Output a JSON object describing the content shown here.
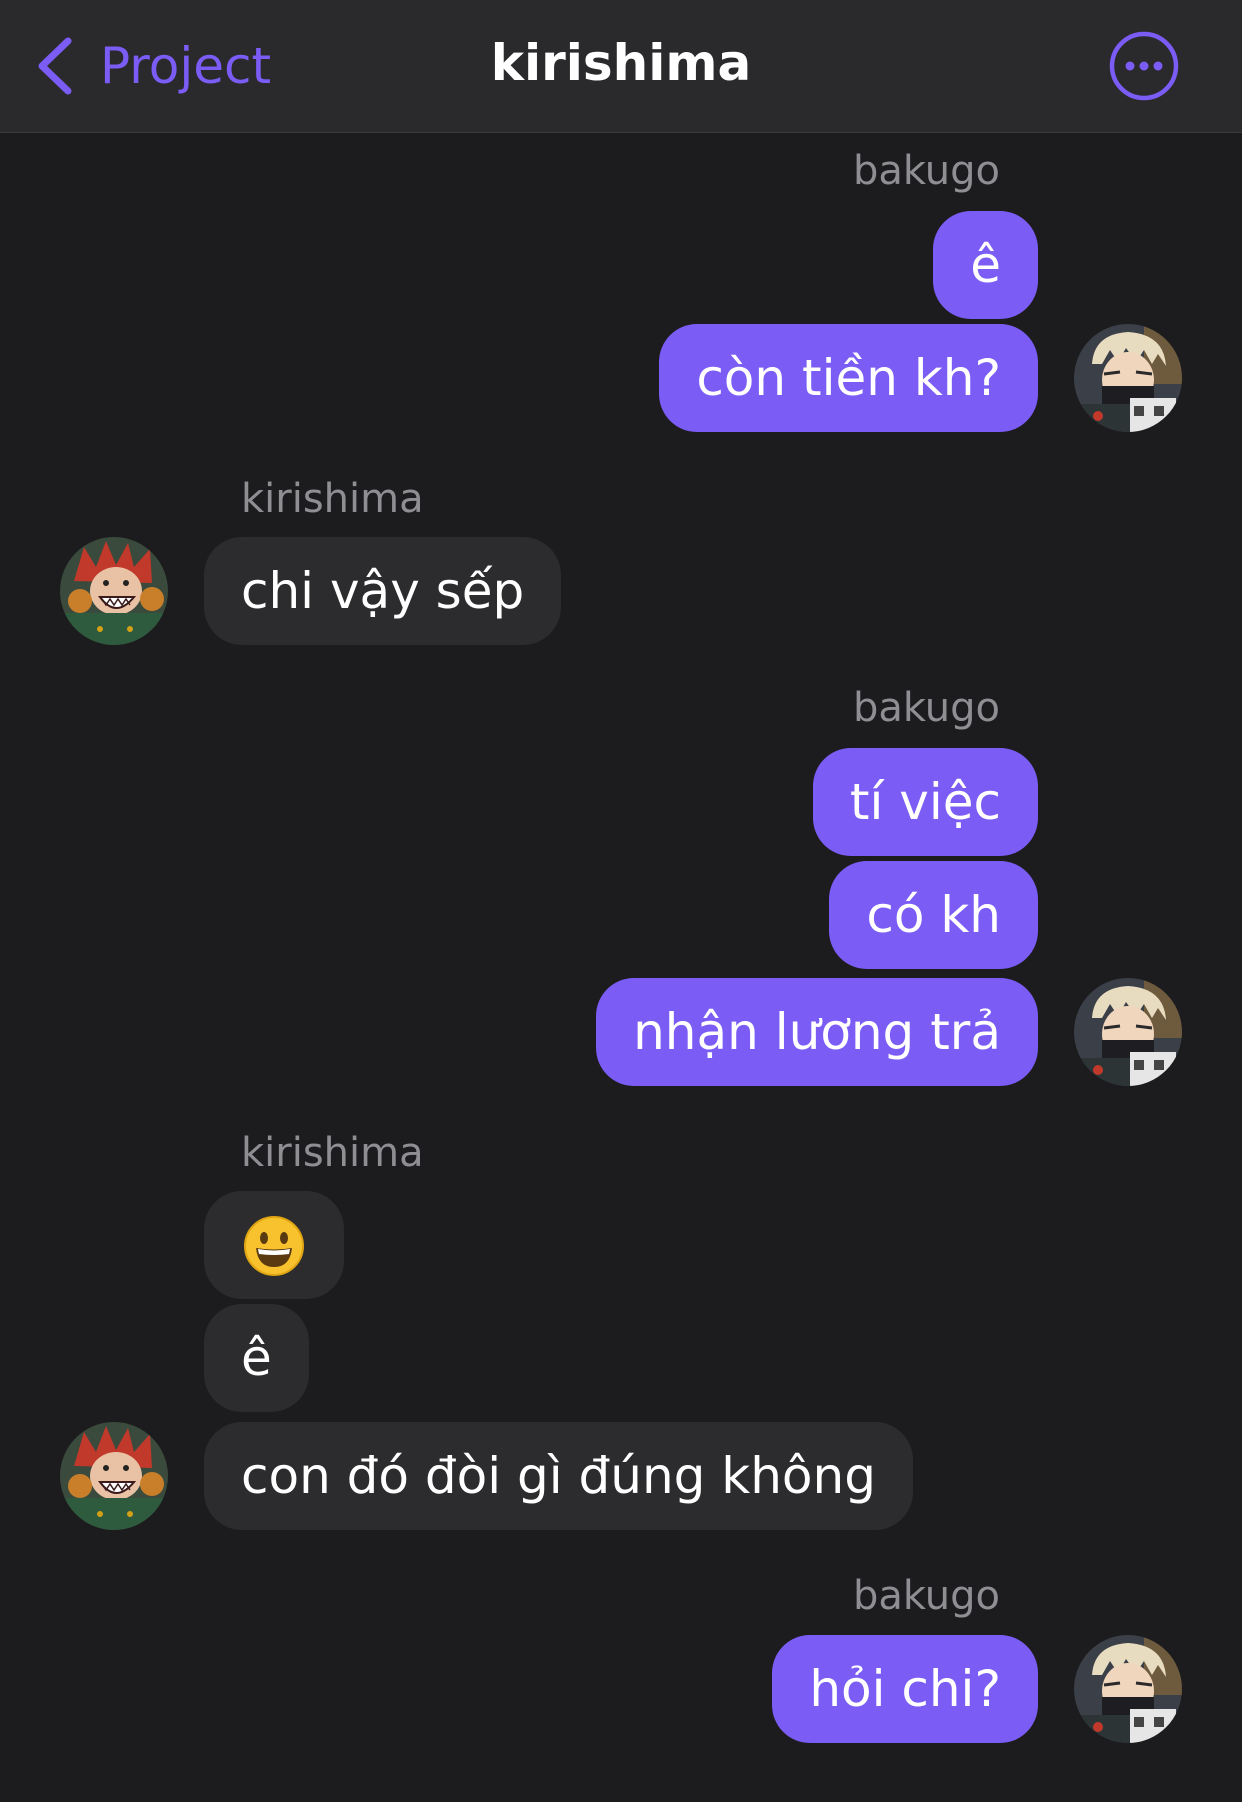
{
  "navbar": {
    "back_label": "Project",
    "title": "kirishima"
  },
  "colors": {
    "accent": "#7b5cf5",
    "background": "#1c1c1e",
    "incoming_bubble": "#2c2c2e",
    "sender_label": "#8e8e93"
  },
  "messages": [
    {
      "sender": "bakugo",
      "side": "right",
      "bubbles": [
        "ê",
        "còn tiền kh?"
      ]
    },
    {
      "sender": "kirishima",
      "side": "left",
      "bubbles": [
        "chi vậy sếp"
      ]
    },
    {
      "sender": "bakugo",
      "side": "right",
      "bubbles": [
        "tí việc",
        "có kh",
        "nhận lương trả"
      ]
    },
    {
      "sender": "kirishima",
      "side": "left",
      "bubbles": [
        "😀",
        "ê",
        "con đó đòi gì đúng không"
      ]
    },
    {
      "sender": "bakugo",
      "side": "right",
      "bubbles": [
        "hỏi chi?"
      ]
    }
  ],
  "icons": {
    "back": "chevron-left-icon",
    "more": "ellipsis-circle-icon",
    "emoji": "grinning-face"
  }
}
